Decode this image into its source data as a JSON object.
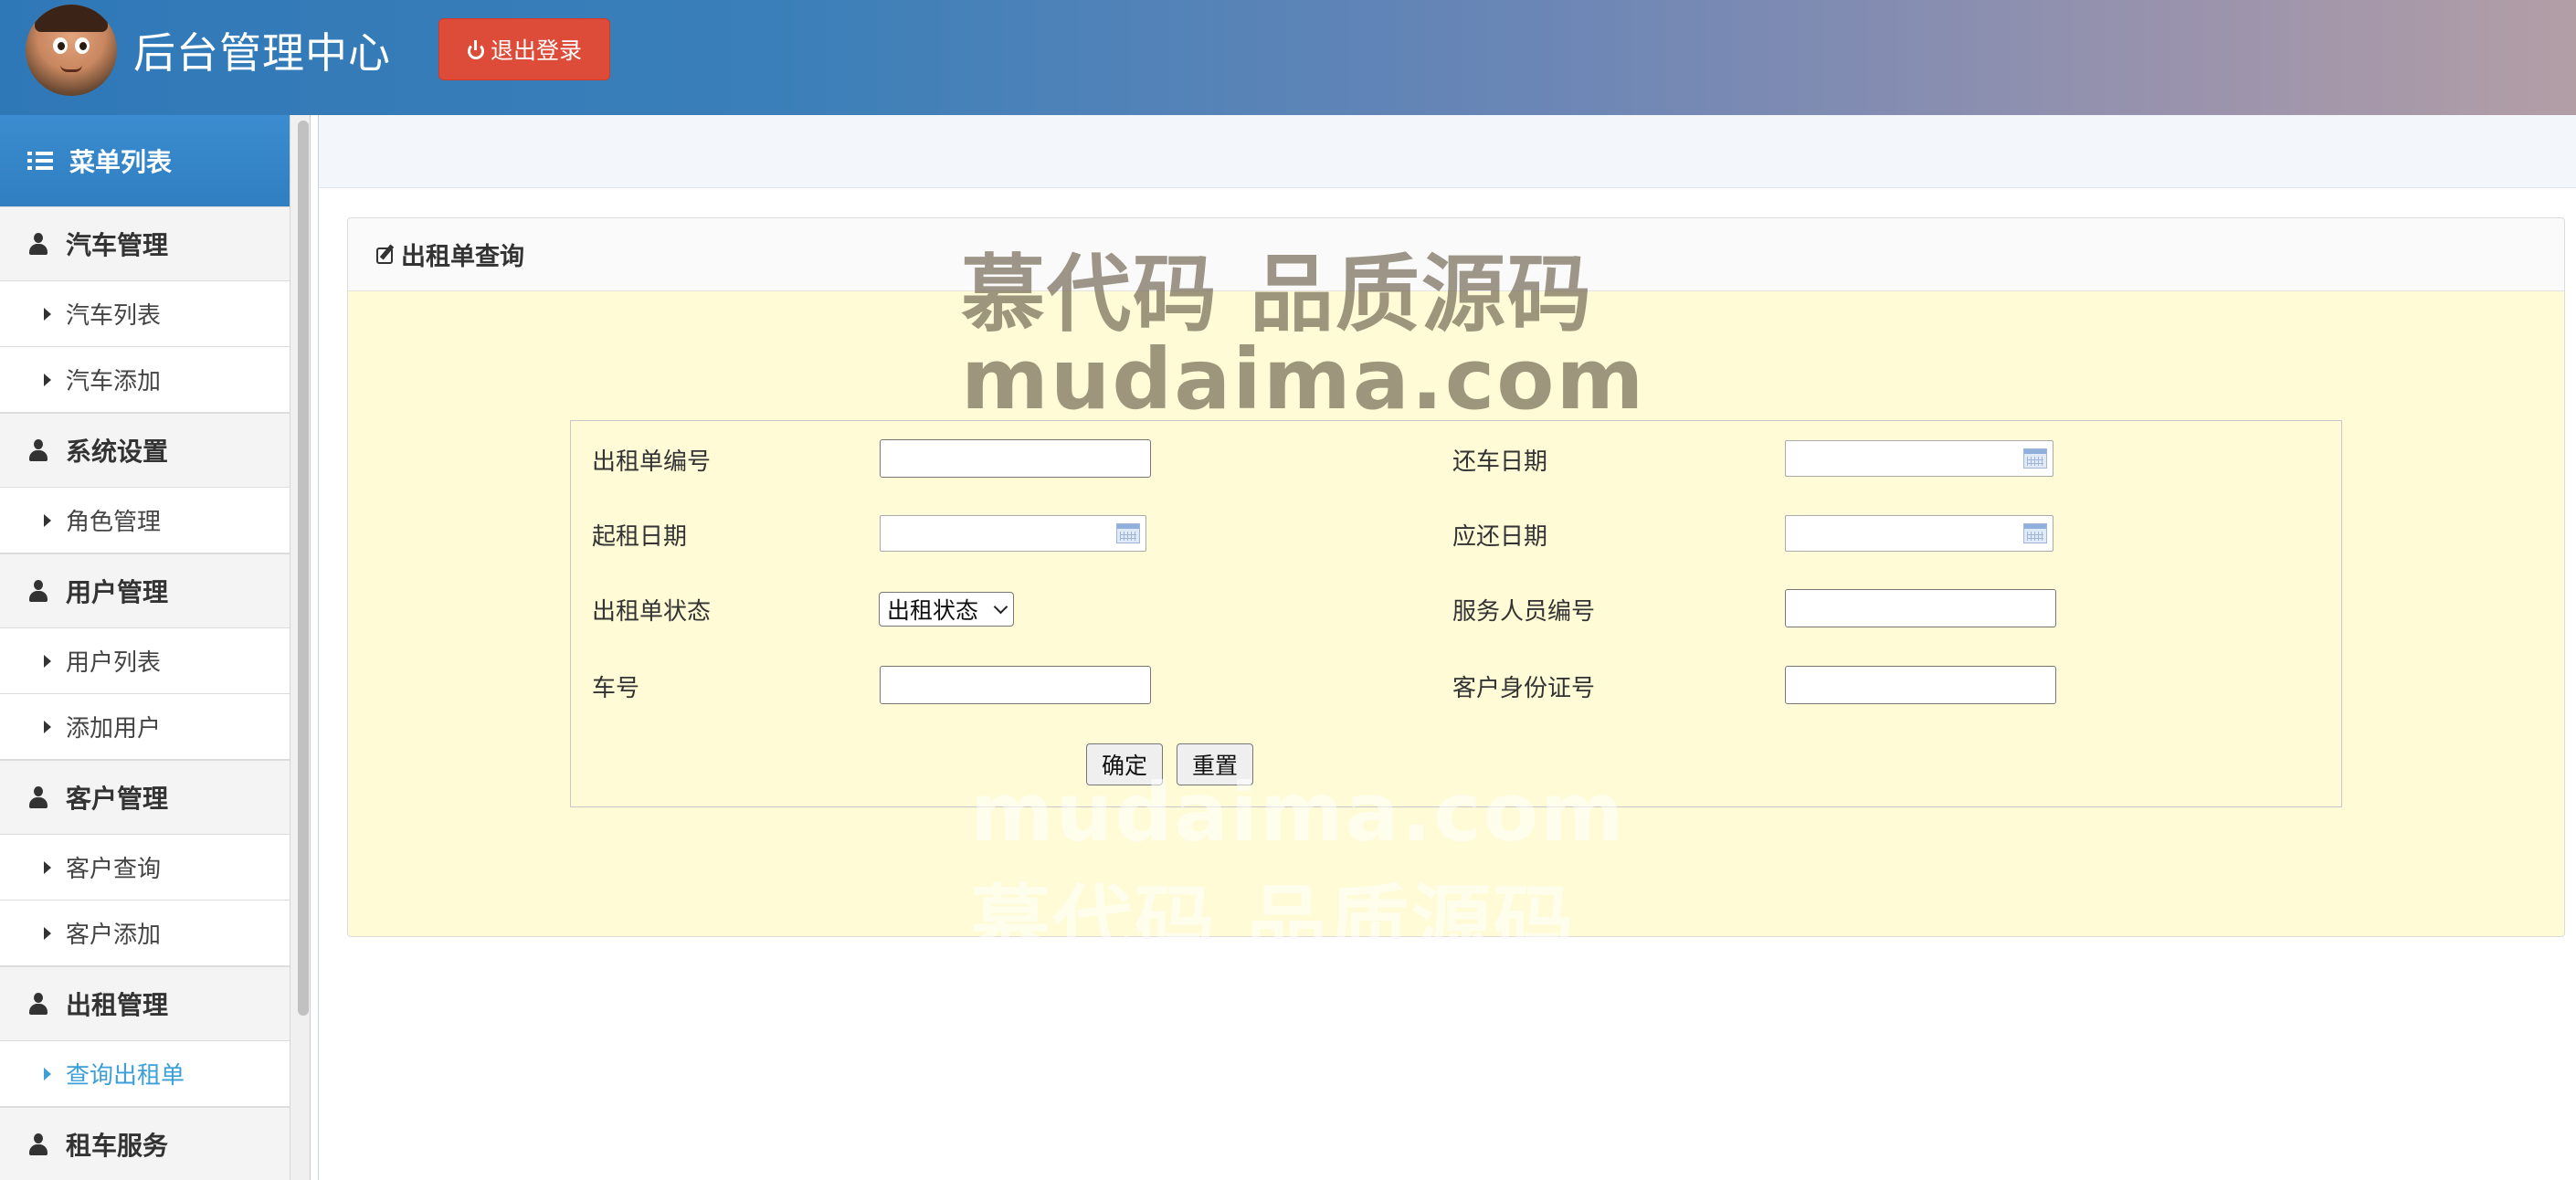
{
  "header": {
    "title": "后台管理中心",
    "logout_label": "退出登录"
  },
  "sidebar": {
    "menu_title": "菜单列表",
    "groups": [
      {
        "label": "汽车管理",
        "items": [
          {
            "label": "汽车列表"
          },
          {
            "label": "汽车添加"
          }
        ]
      },
      {
        "label": "系统设置",
        "items": [
          {
            "label": "角色管理"
          }
        ]
      },
      {
        "label": "用户管理",
        "items": [
          {
            "label": "用户列表"
          },
          {
            "label": "添加用户"
          }
        ]
      },
      {
        "label": "客户管理",
        "items": [
          {
            "label": "客户查询"
          },
          {
            "label": "客户添加"
          }
        ]
      },
      {
        "label": "出租管理",
        "items": [
          {
            "label": "查询出租单",
            "active": true
          }
        ]
      },
      {
        "label": "租车服务",
        "items": []
      }
    ]
  },
  "panel": {
    "title": "出租单查询"
  },
  "form": {
    "order_no_label": "出租单编号",
    "return_date_label": "还车日期",
    "start_date_label": "起租日期",
    "due_date_label": "应还日期",
    "status_label": "出租单状态",
    "status_selected": "出租状态",
    "staff_no_label": "服务人员编号",
    "car_no_label": "车号",
    "customer_id_label": "客户身份证号",
    "confirm_label": "确定",
    "reset_label": "重置"
  },
  "watermark": {
    "line1": "慕代码 品质源码",
    "line2": "mudaima.com"
  },
  "colors": {
    "header_start": "#2f78b8",
    "header_end": "#b39ea6",
    "logout_bg": "#dd4b39",
    "menu_header": "#2f7fc1",
    "active_link": "#3c9fd8",
    "panel_bg": "#fffbd6"
  }
}
